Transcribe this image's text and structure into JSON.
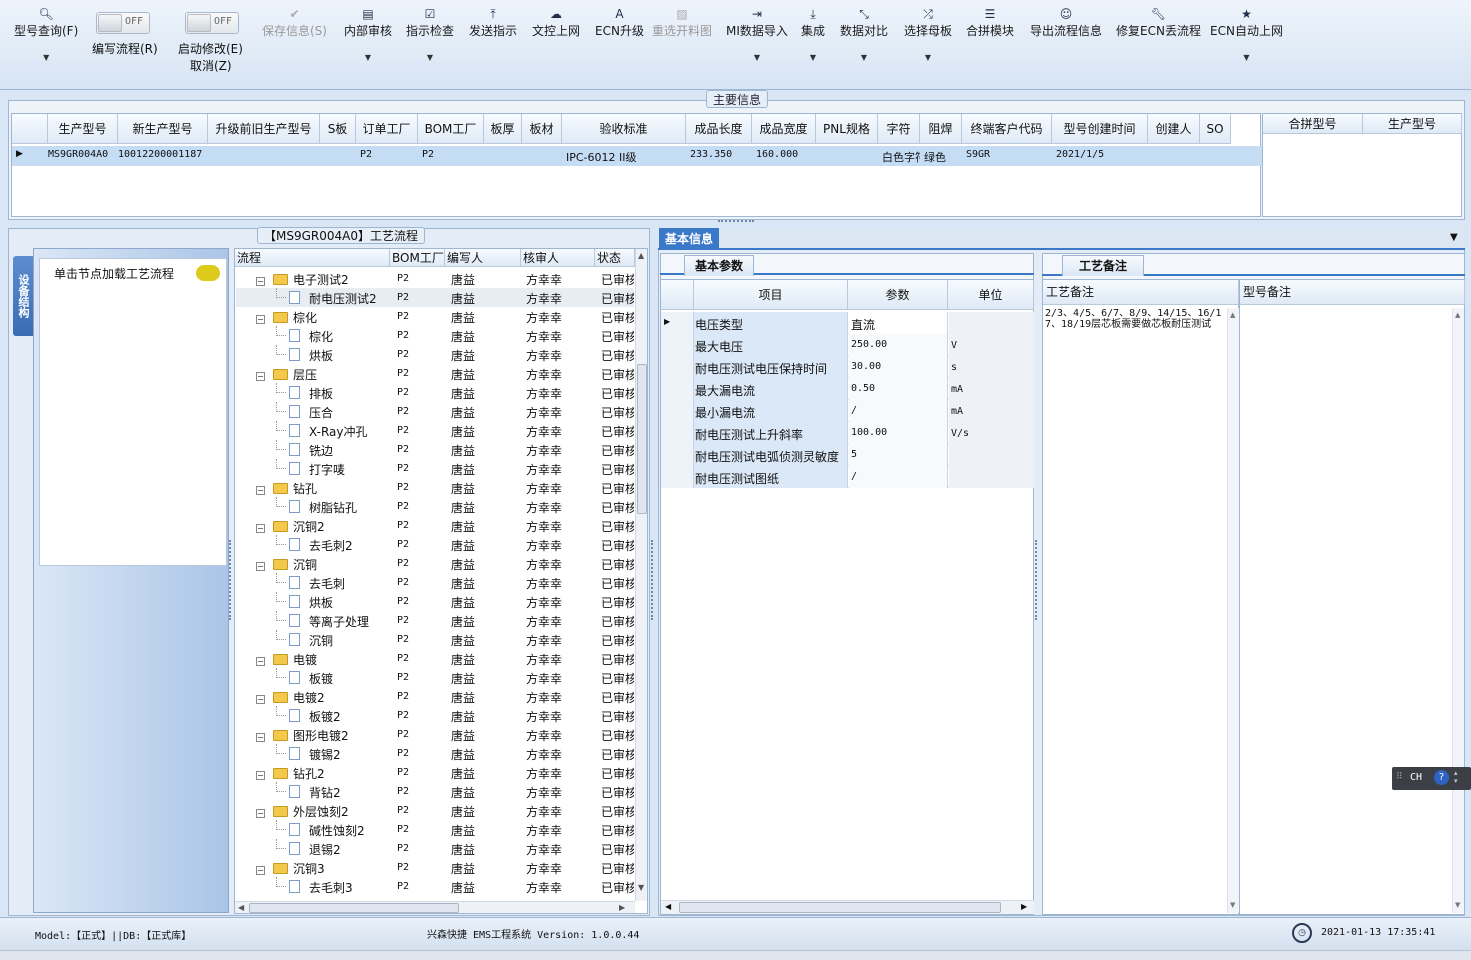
{
  "toolbar": {
    "buttons": [
      {
        "label": "型号查询(F)",
        "icon": "search-icon",
        "has_dropdown": true,
        "enabled": true
      },
      {
        "label": "保存信息(S)",
        "icon": "check-icon",
        "has_dropdown": false,
        "enabled": false
      },
      {
        "label": "内部审核",
        "icon": "printer-icon",
        "has_dropdown": true,
        "enabled": true
      },
      {
        "label": "指示检查",
        "icon": "checkbox-icon",
        "has_dropdown": true,
        "enabled": true
      },
      {
        "label": "发送指示",
        "icon": "upload-icon",
        "has_dropdown": false,
        "enabled": true
      },
      {
        "label": "文控上网",
        "icon": "cloud-upload-icon",
        "has_dropdown": false,
        "enabled": true
      },
      {
        "label": "ECN升级",
        "icon": "font-icon",
        "has_dropdown": false,
        "enabled": true
      },
      {
        "label": "重选开料图",
        "icon": "picture-icon",
        "has_dropdown": false,
        "enabled": false
      },
      {
        "label": "MI数据导入",
        "icon": "login-icon",
        "has_dropdown": true,
        "enabled": true
      },
      {
        "label": "集成",
        "icon": "download-icon",
        "has_dropdown": true,
        "enabled": true
      },
      {
        "label": "数据对比",
        "icon": "compress-icon",
        "has_dropdown": true,
        "enabled": true
      },
      {
        "label": "选择母板",
        "icon": "shuffle-icon",
        "has_dropdown": true,
        "enabled": true
      },
      {
        "label": "合拼模块",
        "icon": "list-icon",
        "has_dropdown": false,
        "enabled": true
      },
      {
        "label": "导出流程信息",
        "icon": "smile-icon",
        "has_dropdown": false,
        "enabled": true
      },
      {
        "label": "修复ECN丢流程",
        "icon": "wrench-icon",
        "has_dropdown": false,
        "enabled": true
      },
      {
        "label": "ECN自动上网",
        "icon": "star-icon",
        "has_dropdown": true,
        "enabled": true
      }
    ],
    "toggle_edit_flow": {
      "state": "OFF",
      "label": "编写流程(R)"
    },
    "toggle_auto_modify": {
      "state": "OFF",
      "label": "启动修改(E)",
      "label2": "取消(Z)"
    }
  },
  "main_info": {
    "title": "主要信息",
    "columns": [
      "生产型号",
      "新生产型号",
      "升级前旧生产型号",
      "S板",
      "订单工厂",
      "BOM工厂",
      "板厚",
      "板材",
      "验收标准",
      "成品长度",
      "成品宽度",
      "PNL规格",
      "字符",
      "阻焊",
      "终端客户代码",
      "型号创建时间",
      "创建人",
      "SO"
    ],
    "row": [
      "MS9GR004A0",
      "10012200001187",
      "",
      "",
      "P2",
      "P2",
      "",
      "",
      "IPC-6012 II级",
      "233.350",
      "160.000",
      "",
      "白色字符",
      "绿色",
      "S9GR",
      "2021/1/5",
      "",
      ""
    ],
    "right_columns": [
      "合拼型号",
      "生产型号"
    ]
  },
  "process": {
    "title": "【MS9GR004A0】工艺流程",
    "side_tab": "设备结构",
    "hint": "单击节点加载工艺流程",
    "columns": [
      "流程",
      "BOM工厂",
      "编写人",
      "核审人",
      "状态"
    ],
    "rows": [
      {
        "level": 0,
        "name": "电子测试2",
        "bom": "P2",
        "writer": "唐益",
        "reviewer": "方幸幸",
        "status": "已审核"
      },
      {
        "level": 1,
        "name": "耐电压测试2",
        "bom": "P2",
        "writer": "唐益",
        "reviewer": "方幸幸",
        "status": "已审核"
      },
      {
        "level": 0,
        "name": "棕化",
        "bom": "P2",
        "writer": "唐益",
        "reviewer": "方幸幸",
        "status": "已审核"
      },
      {
        "level": 1,
        "name": "棕化",
        "bom": "P2",
        "writer": "唐益",
        "reviewer": "方幸幸",
        "status": "已审核"
      },
      {
        "level": 1,
        "name": "烘板",
        "bom": "P2",
        "writer": "唐益",
        "reviewer": "方幸幸",
        "status": "已审核"
      },
      {
        "level": 0,
        "name": "层压",
        "bom": "P2",
        "writer": "唐益",
        "reviewer": "方幸幸",
        "status": "已审核"
      },
      {
        "level": 1,
        "name": "排板",
        "bom": "P2",
        "writer": "唐益",
        "reviewer": "方幸幸",
        "status": "已审核"
      },
      {
        "level": 1,
        "name": "压合",
        "bom": "P2",
        "writer": "唐益",
        "reviewer": "方幸幸",
        "status": "已审核"
      },
      {
        "level": 1,
        "name": "X-Ray冲孔",
        "bom": "P2",
        "writer": "唐益",
        "reviewer": "方幸幸",
        "status": "已审核"
      },
      {
        "level": 1,
        "name": "铣边",
        "bom": "P2",
        "writer": "唐益",
        "reviewer": "方幸幸",
        "status": "已审核"
      },
      {
        "level": 1,
        "name": "打字唛",
        "bom": "P2",
        "writer": "唐益",
        "reviewer": "方幸幸",
        "status": "已审核"
      },
      {
        "level": 0,
        "name": "钻孔",
        "bom": "P2",
        "writer": "唐益",
        "reviewer": "方幸幸",
        "status": "已审核"
      },
      {
        "level": 1,
        "name": "树脂钻孔",
        "bom": "P2",
        "writer": "唐益",
        "reviewer": "方幸幸",
        "status": "已审核"
      },
      {
        "level": 0,
        "name": "沉铜2",
        "bom": "P2",
        "writer": "唐益",
        "reviewer": "方幸幸",
        "status": "已审核"
      },
      {
        "level": 1,
        "name": "去毛刺2",
        "bom": "P2",
        "writer": "唐益",
        "reviewer": "方幸幸",
        "status": "已审核"
      },
      {
        "level": 0,
        "name": "沉铜",
        "bom": "P2",
        "writer": "唐益",
        "reviewer": "方幸幸",
        "status": "已审核"
      },
      {
        "level": 1,
        "name": "去毛刺",
        "bom": "P2",
        "writer": "唐益",
        "reviewer": "方幸幸",
        "status": "已审核"
      },
      {
        "level": 1,
        "name": "烘板",
        "bom": "P2",
        "writer": "唐益",
        "reviewer": "方幸幸",
        "status": "已审核"
      },
      {
        "level": 1,
        "name": "等离子处理",
        "bom": "P2",
        "writer": "唐益",
        "reviewer": "方幸幸",
        "status": "已审核"
      },
      {
        "level": 1,
        "name": "沉铜",
        "bom": "P2",
        "writer": "唐益",
        "reviewer": "方幸幸",
        "status": "已审核"
      },
      {
        "level": 0,
        "name": "电镀",
        "bom": "P2",
        "writer": "唐益",
        "reviewer": "方幸幸",
        "status": "已审核"
      },
      {
        "level": 1,
        "name": "板镀",
        "bom": "P2",
        "writer": "唐益",
        "reviewer": "方幸幸",
        "status": "已审核"
      },
      {
        "level": 0,
        "name": "电镀2",
        "bom": "P2",
        "writer": "唐益",
        "reviewer": "方幸幸",
        "status": "已审核"
      },
      {
        "level": 1,
        "name": "板镀2",
        "bom": "P2",
        "writer": "唐益",
        "reviewer": "方幸幸",
        "status": "已审核"
      },
      {
        "level": 0,
        "name": "图形电镀2",
        "bom": "P2",
        "writer": "唐益",
        "reviewer": "方幸幸",
        "status": "已审核"
      },
      {
        "level": 1,
        "name": "镀锡2",
        "bom": "P2",
        "writer": "唐益",
        "reviewer": "方幸幸",
        "status": "已审核"
      },
      {
        "level": 0,
        "name": "钻孔2",
        "bom": "P2",
        "writer": "唐益",
        "reviewer": "方幸幸",
        "status": "已审核"
      },
      {
        "level": 1,
        "name": "背钻2",
        "bom": "P2",
        "writer": "唐益",
        "reviewer": "方幸幸",
        "status": "已审核"
      },
      {
        "level": 0,
        "name": "外层蚀刻2",
        "bom": "P2",
        "writer": "唐益",
        "reviewer": "方幸幸",
        "status": "已审核"
      },
      {
        "level": 1,
        "name": "碱性蚀刻2",
        "bom": "P2",
        "writer": "唐益",
        "reviewer": "方幸幸",
        "status": "已审核"
      },
      {
        "level": 1,
        "name": "退锡2",
        "bom": "P2",
        "writer": "唐益",
        "reviewer": "方幸幸",
        "status": "已审核"
      },
      {
        "level": 0,
        "name": "沉铜3",
        "bom": "P2",
        "writer": "唐益",
        "reviewer": "方幸幸",
        "status": "已审核"
      },
      {
        "level": 1,
        "name": "去毛刺3",
        "bom": "P2",
        "writer": "唐益",
        "reviewer": "方幸幸",
        "status": "已审核"
      }
    ]
  },
  "basic_info": {
    "tab": "基本信息",
    "subtab": "基本参数",
    "columns": [
      "项目",
      "参数",
      "单位"
    ],
    "rows": [
      {
        "item": "电压类型",
        "param": "直流",
        "unit": ""
      },
      {
        "item": "最大电压",
        "param": "250.00",
        "unit": "V"
      },
      {
        "item": "耐电压测试电压保持时间",
        "param": "30.00",
        "unit": "s"
      },
      {
        "item": "最大漏电流",
        "param": "0.50",
        "unit": "mA"
      },
      {
        "item": "最小漏电流",
        "param": "/",
        "unit": "mA"
      },
      {
        "item": "耐电压测试上升斜率",
        "param": "100.00",
        "unit": "V/s"
      },
      {
        "item": "耐电压测试电弧侦测灵敏度",
        "param": "5",
        "unit": ""
      },
      {
        "item": "耐电压测试图纸",
        "param": "/",
        "unit": ""
      }
    ]
  },
  "notes": {
    "tab": "工艺备注",
    "col1": "工艺备注",
    "col2": "型号备注",
    "process_note": "2/3、4/5、6/7、8/9、14/15、16/17、18/19层芯板需要做芯板耐压测试"
  },
  "ime": {
    "label": "CH"
  },
  "status": {
    "model": "Model:【正式】||DB:【正式库】",
    "app": "兴森快捷 EMS工程系统 Version: 1.0.0.44",
    "datetime": "2021-01-13 17:35:41"
  },
  "colors": {
    "accent": "#3a78c8",
    "selection": "#c5dcf5",
    "header_bg": "#dfeaf6"
  }
}
